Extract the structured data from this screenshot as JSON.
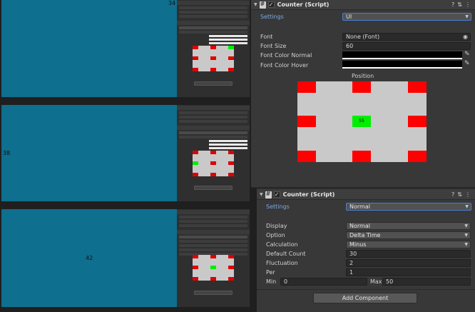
{
  "game_views": [
    {
      "label": "34"
    },
    {
      "label": "38"
    },
    {
      "label": "42"
    }
  ],
  "inspector_top": {
    "component_title": "Counter (Script)",
    "settings_label": "Settings",
    "settings_value": "UI",
    "font_label": "Font",
    "font_value": "None (Font)",
    "font_size_label": "Font Size",
    "font_size_value": "60",
    "font_color_normal_label": "Font Color Normal",
    "font_color_hover_label": "Font Color Hover",
    "position_label": "Position",
    "position_cell_text": "55"
  },
  "inspector_bottom": {
    "component_title": "Counter (Script)",
    "settings_label": "Settings",
    "settings_value": "Normal",
    "display_label": "Display",
    "display_value": "Normal",
    "option_label": "Option",
    "option_value": "Delta Time",
    "calculation_label": "Calculation",
    "calculation_value": "Minus",
    "default_count_label": "Default Count",
    "default_count_value": "30",
    "fluctuation_label": "Fluctuation",
    "fluctuation_value": "2",
    "per_label": "Per",
    "per_value": "1",
    "min_label": "Min",
    "min_value": "0",
    "max_label": "Max",
    "max_value": "50",
    "add_component_label": "Add Component"
  },
  "icons": {
    "header_help": "help-icon",
    "header_settings": "sliders-icon",
    "header_menu": "kebab-menu-icon",
    "font_target": "object-picker-icon",
    "color_picker": "eyedropper-icon"
  },
  "colors": {
    "game_bg": "#0e6f8f",
    "accent_label": "#7fa9e6",
    "marker_red": "#ff0000",
    "marker_green": "#00ee00",
    "position_bg": "#c9c9c9"
  }
}
